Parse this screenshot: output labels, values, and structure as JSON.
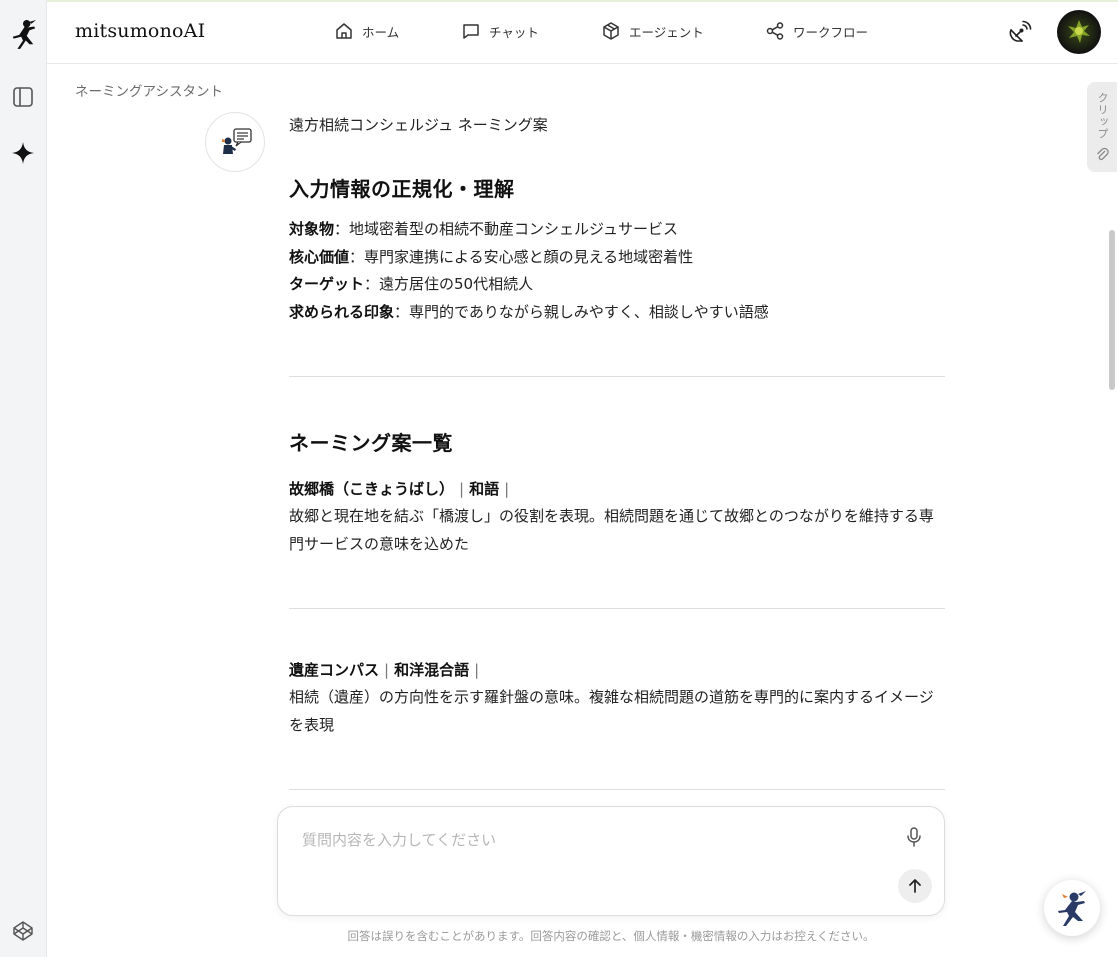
{
  "app": {
    "brand": "mitsumonoAI"
  },
  "nav": [
    {
      "label": "ホーム",
      "icon": "home-icon"
    },
    {
      "label": "チャット",
      "icon": "chat-icon"
    },
    {
      "label": "エージェント",
      "icon": "cube-icon"
    },
    {
      "label": "ワークフロー",
      "icon": "share-icon"
    }
  ],
  "page": {
    "breadcrumb": "ネーミングアシスタント"
  },
  "clip": {
    "label": "クリップ"
  },
  "message": {
    "title": "遠方相続コンシェルジュ ネーミング案",
    "section1": {
      "heading": "入力情報の正規化・理解",
      "items": [
        {
          "key": "対象物",
          "value": "：地域密着型の相続不動産コンシェルジュサービス"
        },
        {
          "key": "核心価値",
          "value": "：専門家連携による安心感と顔の見える地域密着性"
        },
        {
          "key": "ターゲット",
          "value": "：遠方居住の50代相続人"
        },
        {
          "key": "求められる印象",
          "value": "：専門的でありながら親しみやすく、相談しやすい語感"
        }
      ]
    },
    "section2": {
      "heading": "ネーミング案一覧",
      "names": [
        {
          "name": "故郷橋（こきょうばし）",
          "type": "和語",
          "desc": "故郷と現在地を結ぶ「橋渡し」の役割を表現。相続問題を通じて故郷とのつながりを維持する専門サービスの意味を込めた"
        },
        {
          "name": "遺産コンパス",
          "type": "和洋混合語",
          "desc": "相続（遺産）の方向性を示す羅針盤の意味。複雑な相続問題の道筋を専門的に案内するイメージを表現"
        }
      ]
    }
  },
  "composer": {
    "placeholder": "質問内容を入力してください",
    "disclaimer": "回答は誤りを含むことがあります。回答内容の確認と、個人情報・機密情報の入力はお控えください。"
  }
}
